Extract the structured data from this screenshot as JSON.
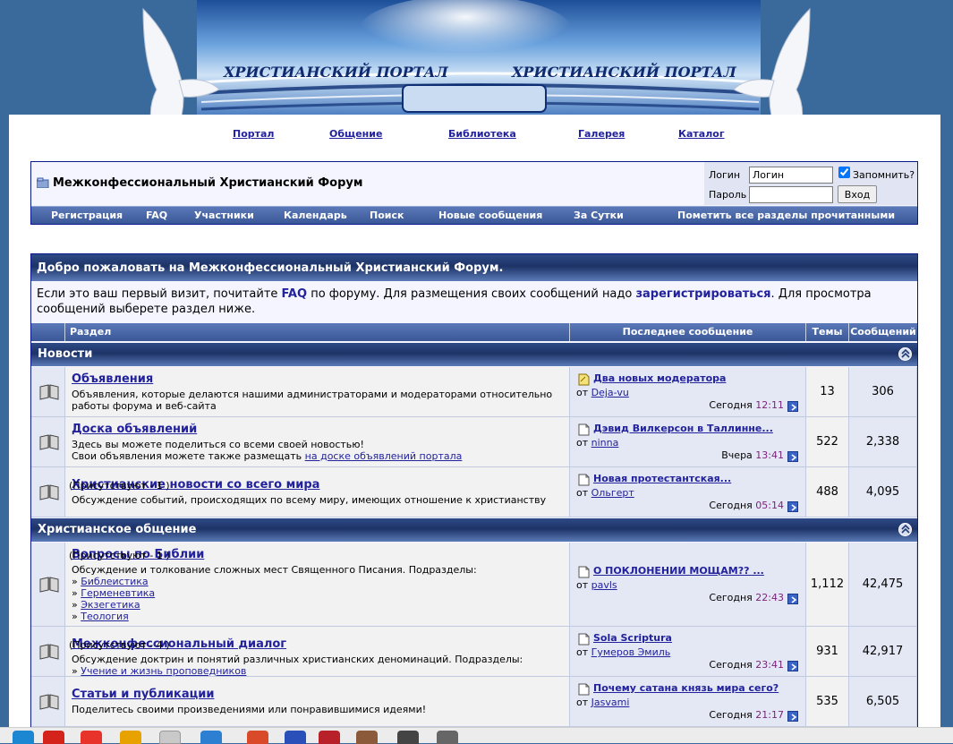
{
  "banner": {
    "left_text": "ХРИСТИАНСКИЙ ПОРТАЛ",
    "right_text": "ХРИСТИАНСКИЙ ПОРТАЛ",
    "logo_text": ""
  },
  "topnav": [
    "Портал",
    "Общение",
    "Библиотека",
    "Галерея",
    "Каталог"
  ],
  "header": {
    "title": "Межконфессиональный Христианский Форум",
    "icon": "forum-folder-icon"
  },
  "login": {
    "login_label": "Логин",
    "login_value": "Логин",
    "remember_label": "Запомнить?",
    "remember_checked": true,
    "password_label": "Пароль",
    "submit_label": "Вход"
  },
  "navbar": [
    "Регистрация",
    "FAQ",
    "Участники",
    "Календарь",
    "Поиск",
    "Новые сообщения",
    "За Сутки",
    "Пометить все разделы прочитанными"
  ],
  "welcome": {
    "title": "Добро пожаловать на Межконфессиональный Христианский Форум.",
    "text_1": "Если это ваш первый визит, почитайте ",
    "faq_link": "FAQ",
    "text_2": " по форуму. Для размещения своих сообщений надо ",
    "register_link": "зарегистрироваться",
    "text_3": ". Для просмотра сообщений выберете раздел ниже."
  },
  "columns": {
    "section": "Раздел",
    "last_post": "Последнее сообщение",
    "threads": "Темы",
    "posts": "Сообщений"
  },
  "categories": [
    {
      "name": "Новости",
      "forums": [
        {
          "title": "Объявления",
          "note": "",
          "description": [
            "Объявления, которые делаются нашими администраторами и модераторами относительно",
            "работы форума и веб-сайта"
          ],
          "desc_link_prefix": "",
          "desc_link": "",
          "subforums_label": "",
          "subforums": [],
          "last_title": "Два новых модератора",
          "last_icon": "sticky-note-icon",
          "by_label": "от",
          "last_author": "Deja-vu",
          "last_day": "Сегодня",
          "last_time": "12:11",
          "threads": "13",
          "posts": "306"
        },
        {
          "title": "Доска объявлений",
          "note": "",
          "description": [
            "Здесь вы можете поделиться со всеми своей новостью!"
          ],
          "desc_link_prefix": "Свои объявления можете также размещать ",
          "desc_link": "на доске объявлений портала",
          "subforums_label": "",
          "subforums": [],
          "last_title": "Дэвид Вилкерсон в Таллинне...",
          "last_icon": "document-icon",
          "by_label": "от",
          "last_author": "ninna",
          "last_day": "Вчера",
          "last_time": "13:41",
          "threads": "522",
          "posts": "2,338"
        },
        {
          "title": "Христианские новости со всего мира",
          "note": "(Присутствуют - 1 )",
          "description": [
            "Обсуждение событий, происходящих по всему миру, имеющих отношение к христианству"
          ],
          "desc_link_prefix": "",
          "desc_link": "",
          "subforums_label": "",
          "subforums": [],
          "last_title": "Новая протестантская...",
          "last_icon": "document-icon",
          "by_label": "от",
          "last_author": "Ольгерт",
          "last_day": "Сегодня",
          "last_time": "05:14",
          "threads": "488",
          "posts": "4,095"
        }
      ]
    },
    {
      "name": "Христианское общение",
      "forums": [
        {
          "title": "Вопросы по Библии",
          "note": "(Присутствуют - 1 )",
          "description": [
            "Обсуждение и толкование сложных мест Священного Писания. Подразделы:"
          ],
          "desc_link_prefix": "",
          "desc_link": "",
          "subforums_label": "»",
          "subforums": [
            "Библеистика",
            "Герменевтика",
            "Экзегетика",
            "Теология"
          ],
          "last_title": "О ПОКЛОНЕНИИ МОЩАМ?? ...",
          "last_icon": "document-icon",
          "by_label": "от",
          "last_author": "pavls",
          "last_day": "Сегодня",
          "last_time": "22:43",
          "threads": "1,112",
          "posts": "42,475"
        },
        {
          "title": "Межконфессиональный диалог",
          "note": "(Присутствуют - 4 )",
          "description": [
            "Обсуждение доктрин и понятий различных христианских деноминаций. Подразделы:"
          ],
          "desc_link_prefix": "",
          "desc_link": "",
          "subforums_label": "»",
          "subforums": [
            "Учение и жизнь проповедников"
          ],
          "last_title": "Sola Scriptura",
          "last_icon": "document-icon",
          "by_label": "от",
          "last_author": "Гумеров Эмиль",
          "last_day": "Сегодня",
          "last_time": "23:41",
          "threads": "931",
          "posts": "42,917"
        },
        {
          "title": "Статьи и публикации",
          "note": "",
          "description": [
            "Поделитесь своими произведениями или понравившимися идеями!"
          ],
          "desc_link_prefix": "",
          "desc_link": "",
          "subforums_label": "",
          "subforums": [],
          "last_title": "Почему сатана князь мира сего?",
          "last_icon": "document-icon",
          "by_label": "от",
          "last_author": "Jasvami",
          "last_day": "Сегодня",
          "last_time": "21:17",
          "threads": "535",
          "posts": "6,505"
        }
      ]
    }
  ],
  "taskbar": {
    "apps": [
      "windows-search-icon",
      "opera-browser-icon",
      "yandex-browser-icon",
      "file-explorer-icon",
      "terminal-icon",
      "calendar-icon",
      "mail-icon",
      "phone-icon",
      "media-icon",
      "contact-icon",
      "camera-icon",
      "settings-icon"
    ]
  }
}
